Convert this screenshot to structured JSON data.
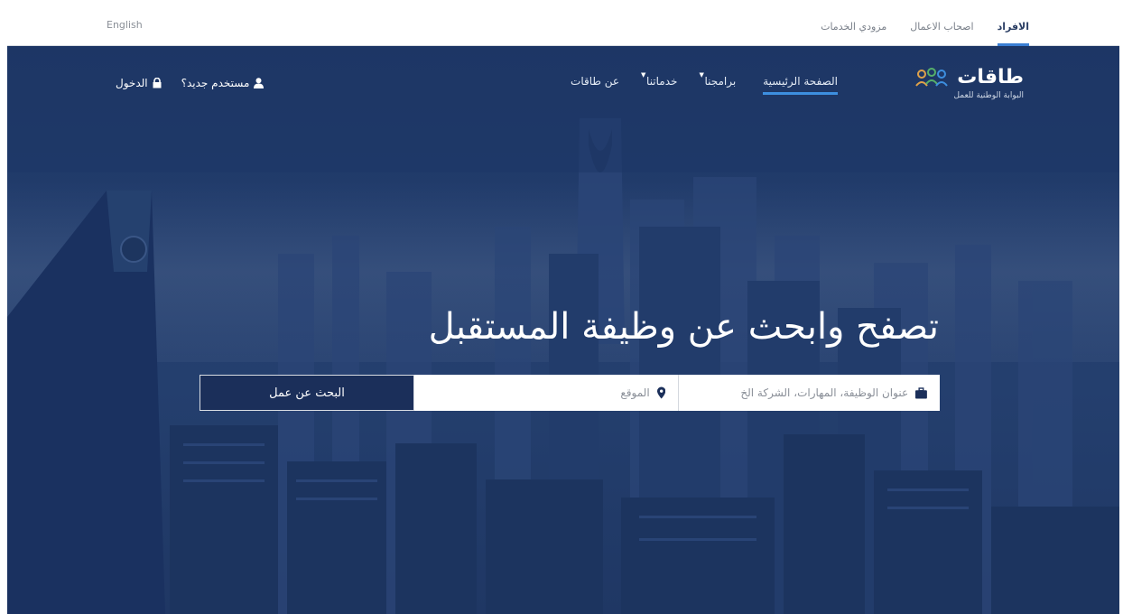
{
  "topbar": {
    "language_link": "English",
    "audience_tabs": [
      {
        "label": "الافراد",
        "active": true
      },
      {
        "label": "اصحاب الاعمال",
        "active": false
      },
      {
        "label": "مزودي الخدمات",
        "active": false
      }
    ]
  },
  "logo": {
    "name": "طاقات",
    "tagline": "البوابة الوطنية للعمل",
    "icon": "people-group-icon"
  },
  "nav": {
    "items": [
      {
        "label": "الصفحة الرئيسية",
        "active": true,
        "dropdown": false
      },
      {
        "label": "برامجنا",
        "active": false,
        "dropdown": true
      },
      {
        "label": "خدماتنا",
        "active": false,
        "dropdown": true
      },
      {
        "label": "عن طاقات",
        "active": false,
        "dropdown": false
      }
    ],
    "new_user": {
      "label": "مستخدم جديد؟",
      "icon": "user-icon"
    },
    "login": {
      "label": "الدخول",
      "icon": "lock-icon"
    }
  },
  "hero": {
    "headline": "تصفح وابحث عن وظيفة المستقبل"
  },
  "search": {
    "job_placeholder": "عنوان الوظيفة، المهارات، الشركة الخ",
    "job_icon": "briefcase-icon",
    "location_placeholder": "الموقع",
    "location_icon": "map-marker-icon",
    "button_label": "البحث عن عمل"
  },
  "colors": {
    "hero_bg": "#203a69",
    "accent": "#3d8fe0",
    "button_bg": "#1b2f5a"
  }
}
